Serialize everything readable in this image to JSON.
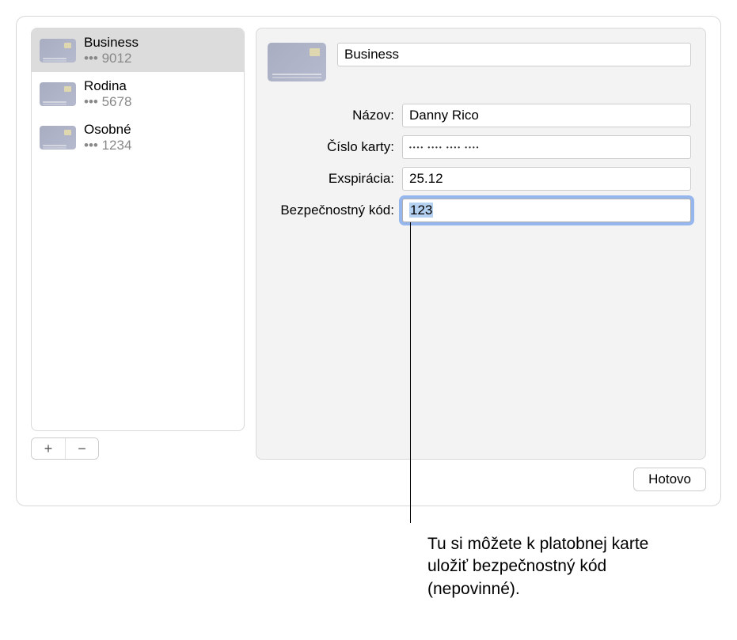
{
  "sidebar": {
    "items": [
      {
        "title": "Business",
        "sub": "••• 9012",
        "selected": true
      },
      {
        "title": "Rodina",
        "sub": "••• 5678",
        "selected": false
      },
      {
        "title": "Osobné",
        "sub": "••• 1234",
        "selected": false
      }
    ]
  },
  "detail": {
    "description": "Business",
    "labels": {
      "name": "Názov:",
      "number": "Číslo karty:",
      "expiry": "Exspirácia:",
      "security": "Bezpečnostný kód:"
    },
    "values": {
      "name": "Danny Rico",
      "number_masked": "•••• •••• •••• ••••",
      "expiry": "25.12",
      "security": "123"
    }
  },
  "buttons": {
    "add": "+",
    "remove": "−",
    "done": "Hotovo"
  },
  "callout": "Tu si môžete k platobnej karte uložiť bezpečnostný kód (nepovinné)."
}
